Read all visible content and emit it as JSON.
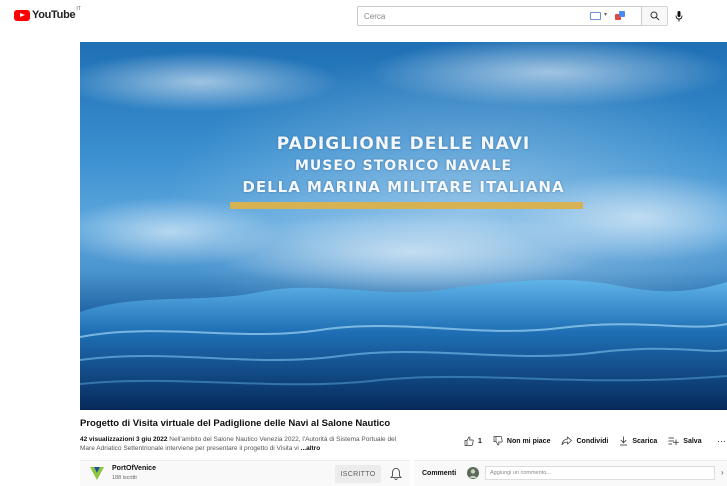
{
  "header": {
    "logo_text": "YouTube",
    "logo_region": "IT",
    "search_placeholder": "Cerca",
    "icons": [
      "youtube-logo-icon",
      "keyboard-icon",
      "translate-icon",
      "search-icon",
      "microphone-icon"
    ]
  },
  "video": {
    "overlay_line1": "PADIGLIONE DELLE NAVI",
    "overlay_line2": "MUSEO STORICO NAVALE",
    "overlay_line3": "DELLA MARINA MILITARE ITALIANA",
    "accent_color": "#d6b253"
  },
  "info": {
    "title": "Progetto di Visita virtuale del Padiglione delle Navi al Salone Nautico",
    "views": "42 visualizzazioni",
    "date": "3 giu 2022",
    "description": "Nell'ambito del Salone Nautico Venezia 2022, l'Autorità di Sistema Portuale del Mare Adriatico Settentrionale interviene per presentare il progetto di Visita vi",
    "more": "...altro"
  },
  "actions": {
    "like_count": "1",
    "dislike": "Non mi piace",
    "share": "Condividi",
    "download": "Scarica",
    "save": "Salva",
    "more": "···"
  },
  "channel": {
    "name": "PortOfVenice",
    "subscribers": "188 iscritti",
    "subscribe_label": "ISCRITTO"
  },
  "comments": {
    "label": "Commenti",
    "placeholder": "Aggiungi un commento..."
  }
}
